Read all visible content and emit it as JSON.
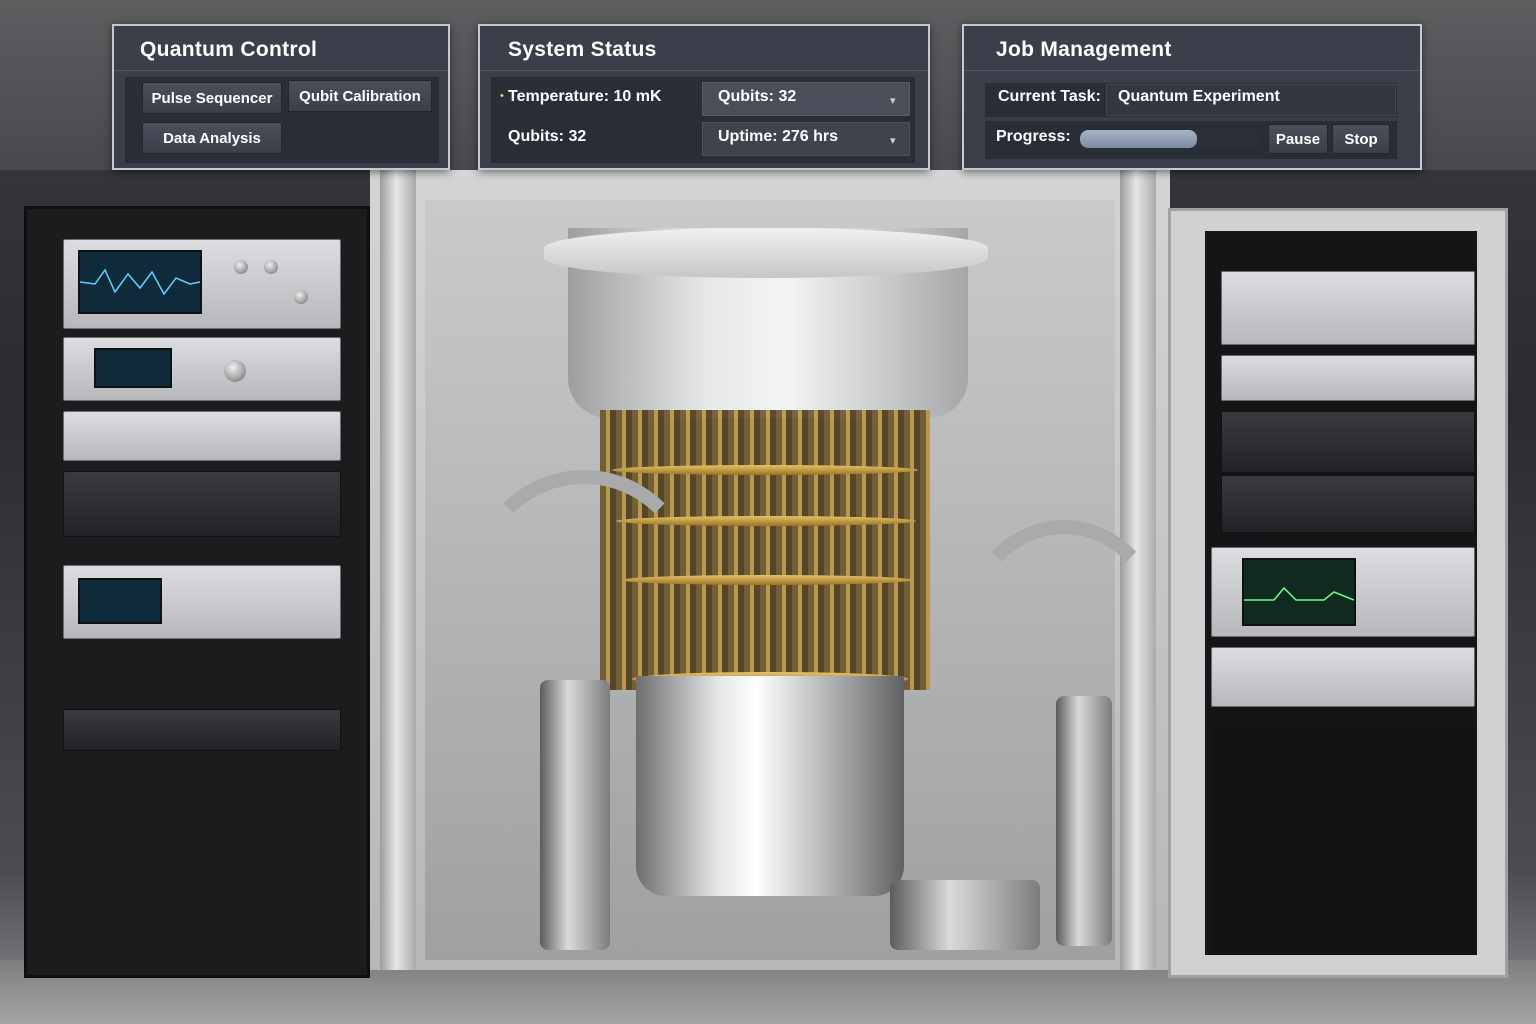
{
  "quantum_control": {
    "title": "Quantum Control",
    "buttons": {
      "pulse_sequencer": "Pulse Sequencer",
      "qubit_calibration": "Qubit Calibration",
      "data_analysis": "Data Analysis"
    }
  },
  "system_status": {
    "title": "System Status",
    "temperature": "Temperature: 10 mK",
    "qubits": "Qubits: 32",
    "qubits_select": "Qubits: 32",
    "uptime_select": "Uptime: 276 hrs"
  },
  "job_management": {
    "title": "Job Management",
    "current_task_label": "Current Task:",
    "current_task_value": "Quantum Experiment",
    "progress_label": "Progress:",
    "progress_fraction": 0.65,
    "pause_label": "Pause",
    "stop_label": "Stop"
  },
  "colors": {
    "panel_bg": "#3a3e48",
    "panel_border": "#c6c9d0",
    "progress_fill": "#8f9bb0"
  }
}
